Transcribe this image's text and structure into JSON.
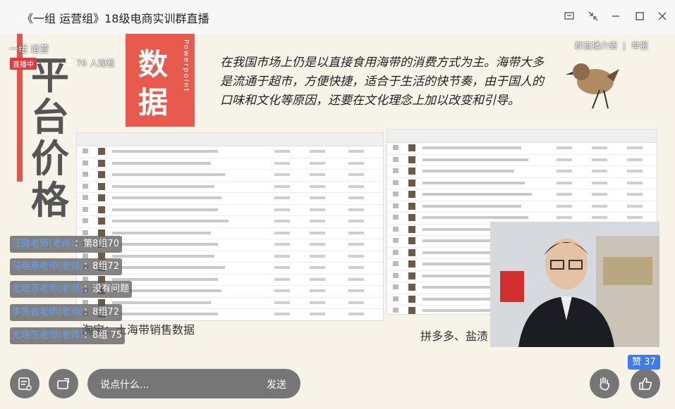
{
  "window": {
    "title": "《一组 运营组》18级电商实训群直播"
  },
  "live": {
    "channel": "一组 运营",
    "badge": "直播中",
    "viewers": "76 人观看",
    "intro_link": "群直播介绍",
    "separator": "|",
    "report_link": "举报"
  },
  "slide": {
    "vertical_title": "平台价格",
    "block_title_1": "数",
    "block_title_2": "据",
    "block_subtitle": "Powerpoint",
    "paragraph": "在我国市场上仍是以直接食用海带的消费方式为主。海带大多是流通于超市，方便快捷，适合于生活的快节奏，由于国人的口味和文化等原因，还要在文化理念上加以改变和引导。",
    "caption_left": "淘宝：土海带销售数据",
    "caption_right": "拼多多、盐渍"
  },
  "comments": [
    {
      "who": "汪健老师(老师)",
      "msg": "：第8组70"
    },
    {
      "who": "马晓燕老师(老师)",
      "msg": "：8组72"
    },
    {
      "who": "尤晓莎老师(老师)",
      "msg": "：没有问题"
    },
    {
      "who": "李亮会老师(老师)",
      "msg": "：8组72"
    },
    {
      "who": "尤晓莎老师(老师)",
      "msg": "：8组 75"
    }
  ],
  "bottom": {
    "input_placeholder": "说点什么...",
    "send_label": "发送",
    "likes_label": "赞 37"
  },
  "icons": {
    "minimize": "minimize-icon",
    "maximize": "maximize-icon",
    "close": "close-icon"
  },
  "colors": {
    "accent_red": "#e75a4d",
    "live_red": "#e0393e",
    "like_blue": "#3f7be9",
    "commenter_blue": "#5aa0ff"
  }
}
